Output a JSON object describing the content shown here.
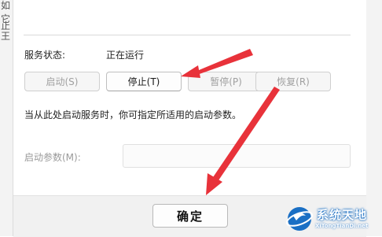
{
  "left_strip_chars": [
    "如",
    "它",
    "止",
    "王"
  ],
  "service_status": {
    "label": "服务状态:",
    "value": "正在运行"
  },
  "buttons": {
    "start": "启动(S)",
    "stop": "停止(T)",
    "pause": "暂停(P)",
    "resume": "恢复(R)"
  },
  "hint_text": "当从此处启动服务时，你可指定所适用的启动参数。",
  "start_params": {
    "label": "启动参数(M):",
    "value": ""
  },
  "ok_button": "确定",
  "watermark": {
    "title": "系统天地",
    "subtitle": "XiTongTianDi.net"
  },
  "colors": {
    "arrow": "#e8323a",
    "watermark_blue": "#1a6fc4"
  }
}
